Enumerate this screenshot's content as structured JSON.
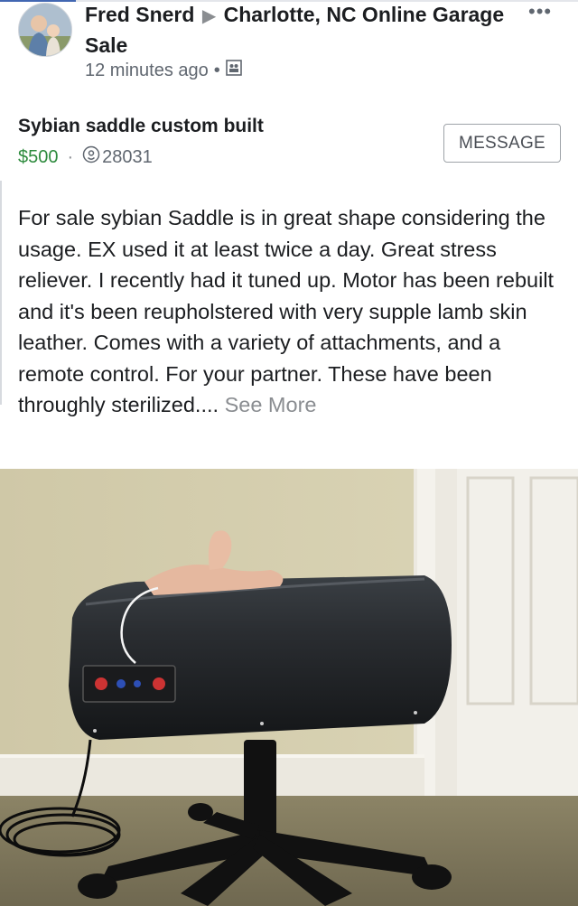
{
  "post": {
    "author": "Fred Snerd",
    "group": "Charlotte, NC Online Garage Sale",
    "time": "12 minutes ago",
    "audience_icon": "group-icon",
    "options_icon": "more-options-icon"
  },
  "listing": {
    "title": "Sybian saddle custom built",
    "price": "$500",
    "zip": "28031",
    "message_label": "MESSAGE",
    "description": "For sale sybian Saddle is in great shape considering the usage. EX used it at least twice a day. Great stress reliever.  I recently had it tuned up. Motor has been rebuilt and it's been reupholstered with very supple lamb skin leather. Comes with a variety of attachments, and a remote control. For your partner. These have been throughly sterilized....",
    "see_more": "See More"
  },
  "colors": {
    "price": "#2e8b3e",
    "muted": "#606770",
    "brand": "#4267b2"
  }
}
